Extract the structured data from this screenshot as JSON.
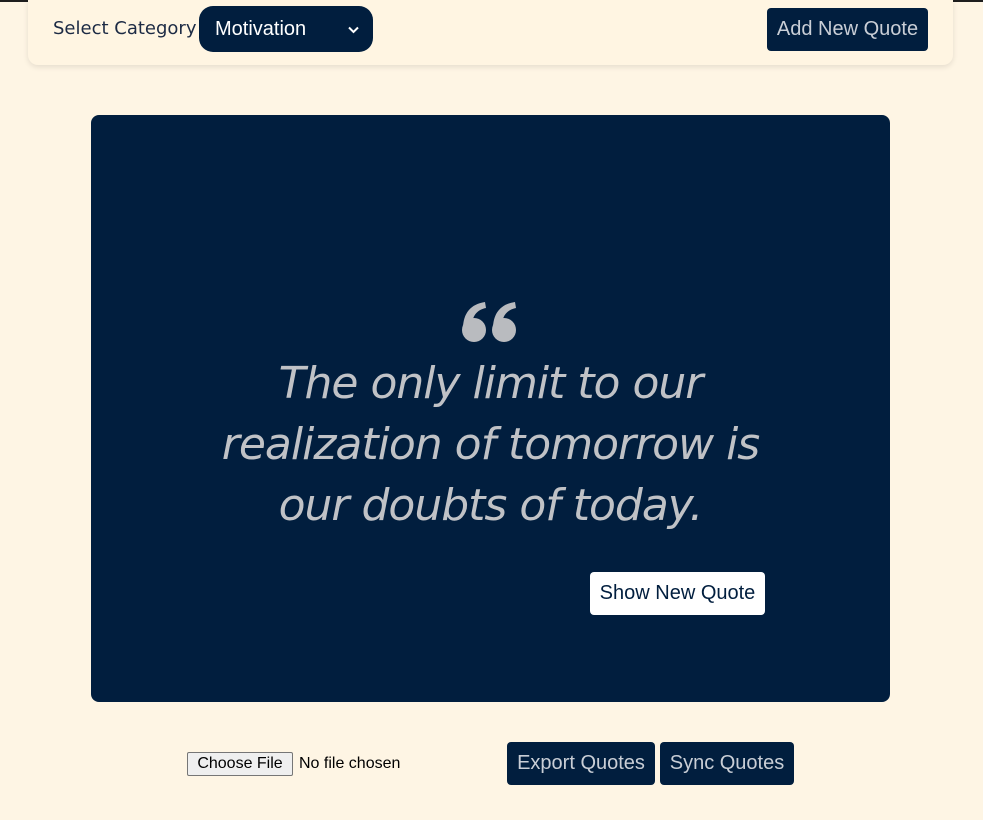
{
  "header": {
    "category_label": "Select Category",
    "category_selected": "Motivation",
    "add_button": "Add New Quote"
  },
  "quote": {
    "text": "The only limit to our realization of tomorrow is our doubts of today.",
    "show_button": "Show New Quote"
  },
  "footer": {
    "file_button": "Choose File",
    "file_status": "No file chosen",
    "export_button": "Export Quotes",
    "sync_button": "Sync Quotes"
  },
  "colors": {
    "background": "#fef5e4",
    "navy": "#011e3e",
    "quote_text": "#c0c2c6",
    "button_text": "#c9ced6"
  }
}
